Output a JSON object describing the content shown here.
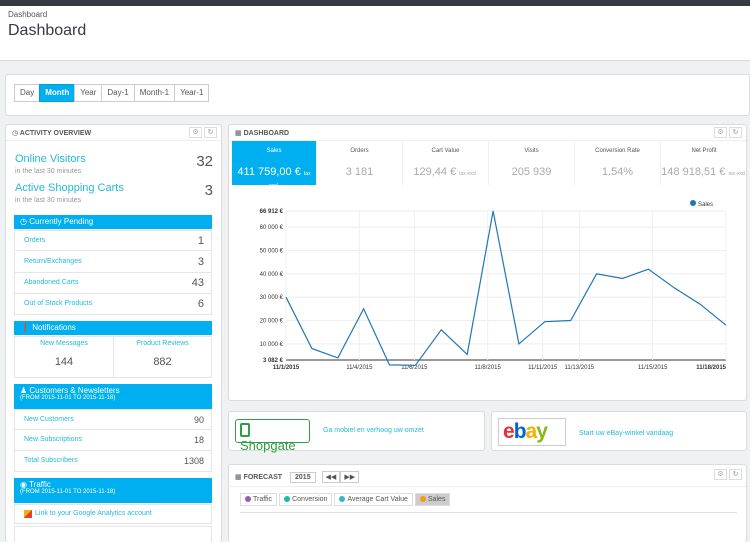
{
  "header": {
    "breadcrumb": "Dashboard",
    "title": "Dashboard"
  },
  "filters": [
    "Day",
    "Month",
    "Year",
    "Day-1",
    "Month-1",
    "Year-1"
  ],
  "activity": {
    "title": "ACTIVITY OVERVIEW",
    "online_label": "Online Visitors",
    "online_sub": "in the last 30 minutes",
    "online_value": "32",
    "carts_label": "Active Shopping Carts",
    "carts_sub": "in the last 30 minutes",
    "carts_value": "3",
    "pending_title": "Currently Pending",
    "pending": [
      {
        "label": "Orders",
        "value": "1"
      },
      {
        "label": "Return/Exchanges",
        "value": "3"
      },
      {
        "label": "Abandoned Carts",
        "value": "43"
      },
      {
        "label": "Out of Stock Products",
        "value": "6"
      }
    ],
    "notif_title": "Notifications",
    "new_messages_label": "New Messages",
    "new_messages_value": "144",
    "reviews_label": "Product Reviews",
    "reviews_value": "882",
    "cust_title": "Customers & Newsletters",
    "cust_range": "(FROM 2015-11-01 TO 2015-11-18)",
    "customers": [
      {
        "label": "New Customers",
        "value": "90"
      },
      {
        "label": "New Subscriptions",
        "value": "18"
      },
      {
        "label": "Total Subscribers",
        "value": "1308"
      }
    ],
    "traffic_title": "Traffic",
    "traffic_range": "(FROM 2015-11-01 TO 2015-11-18)",
    "ga_link": "Link to your Google Analytics account"
  },
  "dashboard": {
    "title": "DASHBOARD",
    "kpis": [
      {
        "label": "Sales",
        "value": "411 759,00 €",
        "suffix": "tax excl."
      },
      {
        "label": "Orders",
        "value": "3 181",
        "suffix": ""
      },
      {
        "label": "Cart Value",
        "value": "129,44 €",
        "suffix": "tax excl."
      },
      {
        "label": "Visits",
        "value": "205 939",
        "suffix": ""
      },
      {
        "label": "Conversion Rate",
        "value": "1.54%",
        "suffix": ""
      },
      {
        "label": "Net Profit",
        "value": "148 918,51 €",
        "suffix": "tax excl."
      }
    ]
  },
  "chart_data": {
    "type": "line",
    "series": [
      {
        "name": "Sales",
        "values": [
          30000,
          8000,
          4000,
          25000,
          1000,
          800,
          16000,
          5500,
          66912,
          10000,
          19500,
          20000,
          40000,
          38000,
          42000,
          34000,
          27000,
          18000
        ]
      }
    ],
    "x_tick_labels": [
      "11/1/2015",
      "11/4/2015",
      "11/6/2015",
      "11/8/2015",
      "11/11/2015",
      "11/13/2015",
      "11/15/2015",
      "11/18/2015"
    ],
    "y_tick_labels": [
      "66 912 €",
      "60 000 €",
      "50 000 €",
      "40 000 €",
      "30 000 €",
      "20 000 €",
      "10 000 €",
      "3 082 €"
    ],
    "ylim": [
      3082,
      66912
    ],
    "grid": true,
    "legend": "top-right",
    "color": "#1f77b4"
  },
  "shopgate": {
    "logo": "Shopgate",
    "text": "Ga mobiel en verhoog uw omzet"
  },
  "ebay": {
    "text": "Start uw eBay-winkel vandaag"
  },
  "forecast": {
    "title": "FORECAST",
    "year": "2015",
    "chips": [
      {
        "label": "Traffic",
        "color": "#9b59b6"
      },
      {
        "label": "Conversion",
        "color": "#1abc9c"
      },
      {
        "label": "Average Cart Value",
        "color": "#35b6d3"
      },
      {
        "label": "Sales",
        "color": "#f39c12"
      }
    ]
  }
}
